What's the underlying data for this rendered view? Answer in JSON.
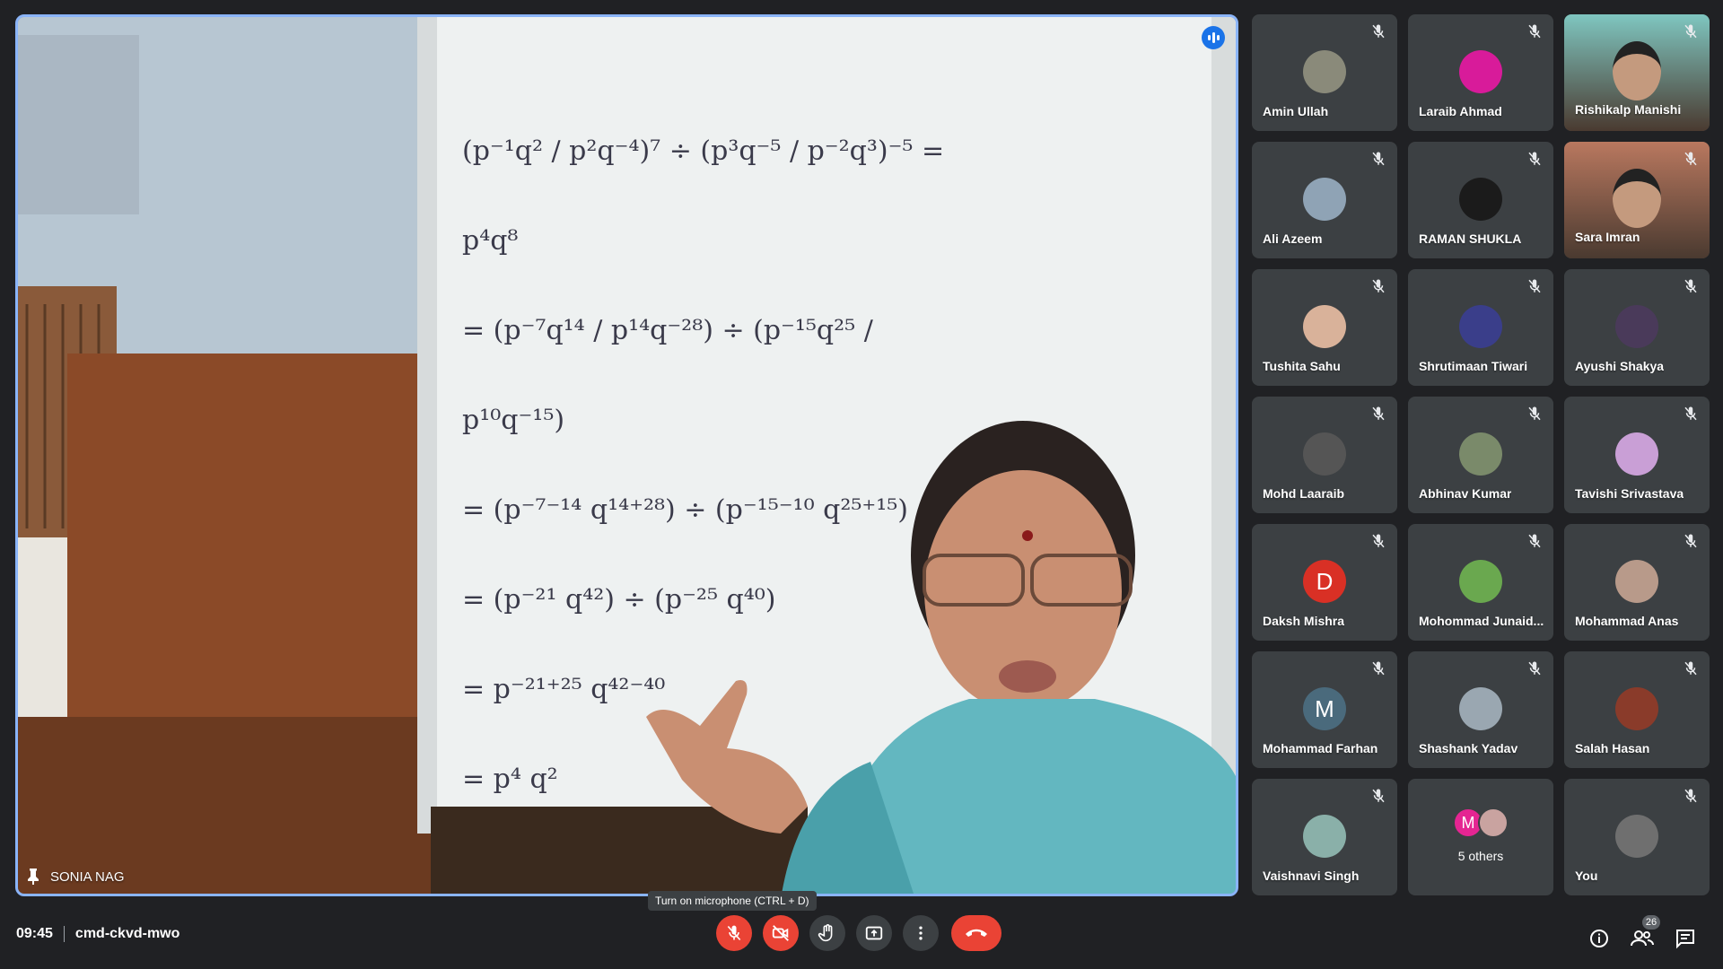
{
  "presenter": {
    "name": "SONIA NAG"
  },
  "whiteboard": {
    "line1": "(p⁻¹q² / p²q⁻⁴)⁷ ÷ (p³q⁻⁵ / p⁻²q³)⁻⁵ = p⁴q⁸",
    "line2": "= (p⁻⁷q¹⁴ / p¹⁴q⁻²⁸) ÷ (p⁻¹⁵q²⁵ / p¹⁰q⁻¹⁵)",
    "line3": "= (p⁻⁷⁻¹⁴ q¹⁴⁺²⁸) ÷ (p⁻¹⁵⁻¹⁰ q²⁵⁺¹⁵)",
    "line4": "= (p⁻²¹ q⁴²) ÷ (p⁻²⁵ q⁴⁰)",
    "line5": "= p⁻²¹⁺²⁵ q⁴²⁻⁴⁰",
    "line6": "= p⁴ q²"
  },
  "participants": [
    {
      "name": "Amin Ullah",
      "avatar_color": "#8a8a7a"
    },
    {
      "name": "Laraib Ahmad",
      "avatar_color": "#d81b9a"
    },
    {
      "name": "Rishikalp Manishi",
      "avatar_color": "#7fc6c0"
    },
    {
      "name": "Ali Azeem",
      "avatar_color": "#8fa3b5"
    },
    {
      "name": "RAMAN SHUKLA",
      "avatar_color": "#1b1b1b"
    },
    {
      "name": "Sara Imran",
      "avatar_color": "#b9785f"
    },
    {
      "name": "Tushita Sahu",
      "avatar_color": "#d9b29a"
    },
    {
      "name": "Shrutimaan Tiwari",
      "avatar_color": "#3a3e8a"
    },
    {
      "name": "Ayushi Shakya",
      "avatar_color": "#4a3a5a"
    },
    {
      "name": "Mohd Laaraib",
      "avatar_color": "#555555"
    },
    {
      "name": "Abhinav Kumar",
      "avatar_color": "#7a8a6a"
    },
    {
      "name": "Tavishi Srivastava",
      "avatar_color": "#c99fd6"
    },
    {
      "name": "Daksh Mishra",
      "avatar_letter": "D",
      "avatar_color": "#d93025"
    },
    {
      "name": "Mohommad Junaid...",
      "avatar_color": "#6aa84f"
    },
    {
      "name": "Mohammad Anas",
      "avatar_color": "#b89a8a"
    },
    {
      "name": "Mohammad Farhan",
      "avatar_letter": "M",
      "avatar_color": "#4a6a7c"
    },
    {
      "name": "Shashank Yadav",
      "avatar_color": "#9aa7b1"
    },
    {
      "name": "Salah Hasan",
      "avatar_color": "#8a3b2a"
    },
    {
      "name": "Vaishnavi Singh",
      "avatar_color": "#8ab0a9"
    },
    {
      "name": "You",
      "avatar_color": "#6f6f6f"
    }
  ],
  "others": {
    "label": "5 others",
    "avatar_letter": "M",
    "avatar_color": "#e52592",
    "avatar2_color": "#c9a3a0"
  },
  "meeting": {
    "time": "09:45",
    "code": "cmd-ckvd-mwo"
  },
  "tooltip": "Turn on microphone (CTRL + D)",
  "people_count": "26",
  "colors": {
    "end_call": "#ea4335",
    "accent": "#8ab4f8",
    "tile_bg": "#3c4043",
    "page_bg": "#202124"
  }
}
